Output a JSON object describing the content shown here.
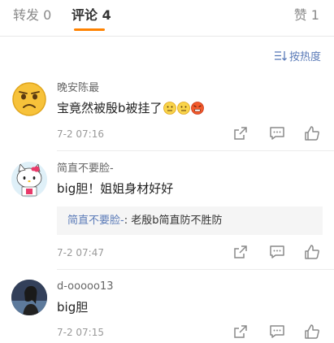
{
  "tabs": {
    "repost": "转发 0",
    "comment": "评论 4",
    "like": "赞 1"
  },
  "sort": {
    "label": "按热度"
  },
  "comments": [
    {
      "username": "晚安陈最",
      "text": "宝竟然被殷b被挂了",
      "time": "7-2 07:16"
    },
    {
      "username": "简直不要脸-",
      "text": "big胆！姐姐身材好好",
      "reply_name": "简直不要脸-",
      "reply_text": ": 老殷b简直防不胜防",
      "time": "7-2 07:47"
    },
    {
      "username": "d-ooooo13",
      "text": "big胆",
      "time": "7-2 07:15"
    }
  ],
  "colors": {
    "accent": "#ff8200",
    "link": "#5b7bb8"
  }
}
